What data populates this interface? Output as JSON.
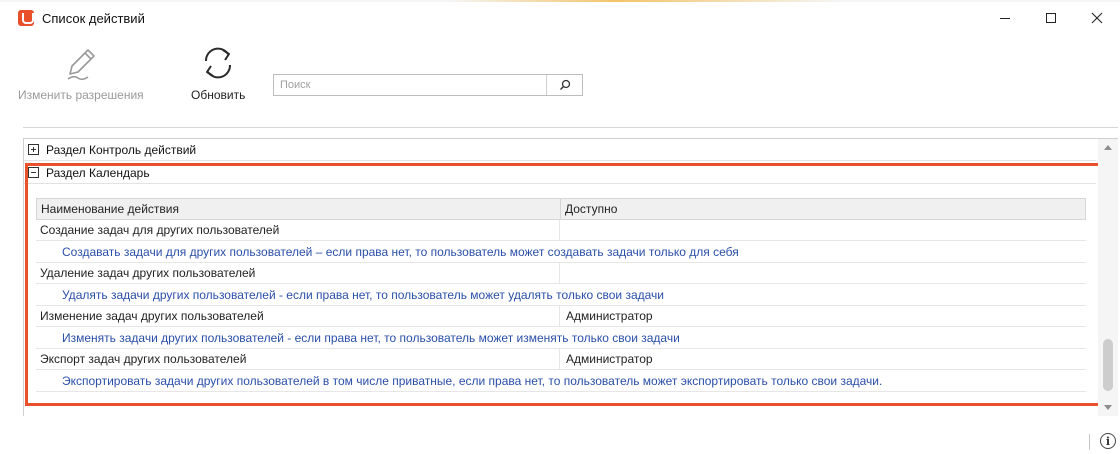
{
  "window": {
    "title": "Список действий",
    "app_icon": "app-logo-icon",
    "controls": {
      "minimize": "—",
      "maximize": "☐",
      "close": "✕"
    }
  },
  "toolbar": {
    "edit_permissions_label": "Изменить разрешения",
    "edit_permissions_icon": "pencil-icon",
    "edit_permissions_enabled": false,
    "refresh_label": "Обновить",
    "refresh_icon": "refresh-icon",
    "search_placeholder": "Поиск",
    "search_icon": "search-icon"
  },
  "grid": {
    "groups": [
      {
        "label": "Раздел Контроль действий",
        "expanded": false
      },
      {
        "label": "Раздел Календарь",
        "expanded": true
      }
    ],
    "columns": [
      "Наименование действия",
      "Доступно"
    ],
    "rows": [
      {
        "name": "Создание задач для других пользователей",
        "available": "",
        "description": "Создавать задачи для других пользователей – если права нет, то пользователь может создавать задачи только для себя"
      },
      {
        "name": "Удаление задач других пользователей",
        "available": "",
        "description": "Удалять задачи других пользователей - если права нет, то пользователь может удалять только свои задачи"
      },
      {
        "name": "Изменение задач других пользователей",
        "available": "Администратор",
        "description": "Изменять задачи других пользователей - если права нет, то пользователь может изменять только свои задачи"
      },
      {
        "name": "Экспорт задач других пользователей",
        "available": "Администратор",
        "description": "Экспортировать задачи других пользователей в том числе приватные, если права нет, то пользователь может экспортировать только свои задачи."
      }
    ],
    "highlight_color": "#e8512a",
    "description_color": "#2a4fa8"
  },
  "statusbar": {
    "info_icon": "info-icon",
    "info_glyph": "i"
  }
}
